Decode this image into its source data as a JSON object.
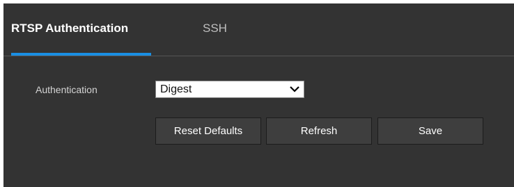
{
  "tabs": [
    {
      "label": "RTSP Authentication",
      "active": true
    },
    {
      "label": "SSH",
      "active": false
    }
  ],
  "form": {
    "authentication_label": "Authentication",
    "authentication_value": "Digest"
  },
  "buttons": {
    "reset_label": "Reset Defaults",
    "refresh_label": "Refresh",
    "save_label": "Save"
  },
  "colors": {
    "background": "#333333",
    "accent": "#1a8fe3",
    "button": "#3e3e3e"
  },
  "icons": {
    "select_arrow": "chevron-down-icon"
  }
}
